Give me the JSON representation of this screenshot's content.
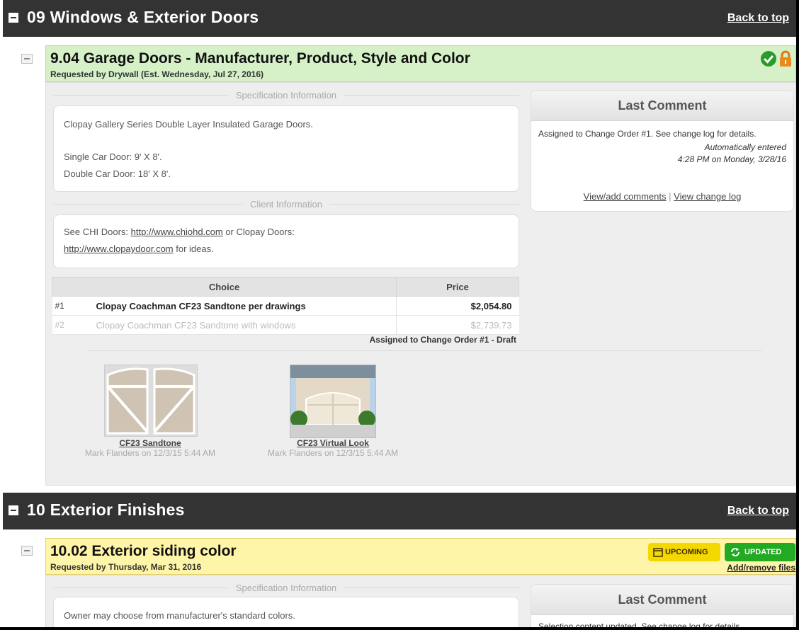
{
  "section09": {
    "title": "09 Windows & Exterior Doors",
    "back": "Back to top"
  },
  "item904": {
    "title": "9.04 Garage Doors - Manufacturer, Product, Style and Color",
    "requested": "Requested by Drywall (Est. Wednesday, Jul 27, 2016)",
    "spec_legend": "Specification Information",
    "spec_lines": [
      "Clopay Gallery Series Double Layer Insulated Garage Doors.",
      "Single Car Door: 9' X 8'.",
      "Double Car Door: 18' X 8'."
    ],
    "client_legend": "Client Information",
    "client_pre": "See CHI Doors: ",
    "client_link1": "http://www.chiohd.com",
    "client_mid": " or Clopay Doors:",
    "client_link2": "http://www.clopaydoor.com",
    "client_post": " for ideas.",
    "table": {
      "headers": [
        "Choice",
        "Price"
      ],
      "rows": [
        {
          "num": "#1",
          "choice": "Clopay Coachman CF23 Sandtone per drawings",
          "price": "$2,054.80"
        },
        {
          "num": "#2",
          "choice": "Clopay Coachman CF23 Sandtone with windows",
          "price": "$2,739.73"
        }
      ]
    },
    "assigned": "Assigned to Change Order #1 - Draft",
    "thumbs": [
      {
        "name": "CF23 Sandtone",
        "meta": "Mark Flanders on 12/3/15 5:44 AM"
      },
      {
        "name": "CF23 Virtual Look",
        "meta": "Mark Flanders on 12/3/15 5:44 AM"
      }
    ],
    "comment": {
      "title": "Last Comment",
      "text": "Assigned to Change Order #1. See change log for details.",
      "auto": "Automatically entered",
      "when": "4:28 PM on Monday, 3/28/16",
      "link1": "View/add comments",
      "sep": "|",
      "link2": "View change log"
    }
  },
  "section10": {
    "title": "10 Exterior Finishes",
    "back": "Back to top"
  },
  "item1002": {
    "title": "10.02 Exterior siding color",
    "requested": "Requested by Thursday, Mar 31, 2016",
    "badge_upcoming": "UPCOMING",
    "badge_updated": "UPDATED",
    "add_files": "Add/remove files",
    "spec_legend": "Specification Information",
    "spec_text": "Owner may choose from manufacturer's standard colors.",
    "comment_title": "Last Comment",
    "comment_text": "Selection content updated. See change log for details."
  },
  "colors": {
    "header_dark": "#333333",
    "approved_green": "#d6f0c8",
    "pending_yellow": "#fff5a8",
    "badge_green": "#22aa22",
    "badge_yellow": "#f5d800"
  },
  "icons": [
    "check-circle-icon",
    "lock-icon",
    "calendar-icon",
    "refresh-icon"
  ]
}
